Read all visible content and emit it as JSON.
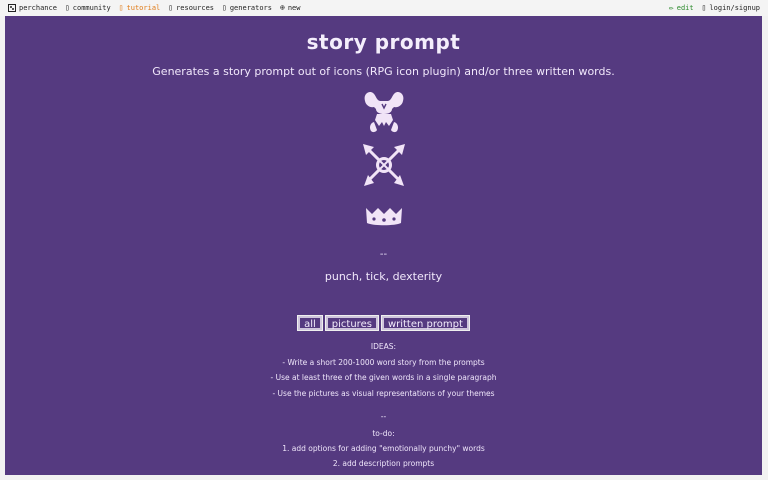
{
  "nav": {
    "left": [
      {
        "label": "perchance",
        "icon": "dice-icon"
      },
      {
        "label": "community",
        "icon": "chat-icon"
      },
      {
        "label": "tutorial",
        "icon": "book-icon"
      },
      {
        "label": "resources",
        "icon": "folder-icon"
      },
      {
        "label": "generators",
        "icon": "grid-icon"
      },
      {
        "label": "new",
        "icon": "plus-circle-icon"
      }
    ],
    "right": [
      {
        "label": "edit",
        "icon": "pencil-icon"
      },
      {
        "label": "login/signup",
        "icon": "user-icon"
      }
    ]
  },
  "page": {
    "title": "story prompt",
    "subtitle": "Generates a story prompt out of icons (RPG icon plugin) and/or three written words.",
    "icons": [
      "flexing-muscles-icon",
      "crossed-arrows-target-icon",
      "crown-icon"
    ],
    "separator": "--",
    "words": "punch, tick, dexterity",
    "buttons": [
      "all",
      "pictures",
      "written prompt"
    ],
    "ideas_heading": "IDEAS:",
    "ideas": [
      "- Write a short 200-1000 word story from the prompts",
      "- Use at least three of the given words in a single paragraph",
      "- Use the pictures as visual representations of your themes"
    ],
    "separator2": "--",
    "todo_heading": "to-do:",
    "todo": [
      "1. add options for adding \"emotionally punchy\" words",
      "2. add description prompts"
    ]
  },
  "colors": {
    "panel_bg": "#553a80",
    "text": "#f0e6fb",
    "icon_fill": "#f1e4f7",
    "tutorial_link": "#e07a16",
    "edit_link": "#2c8a2c"
  }
}
